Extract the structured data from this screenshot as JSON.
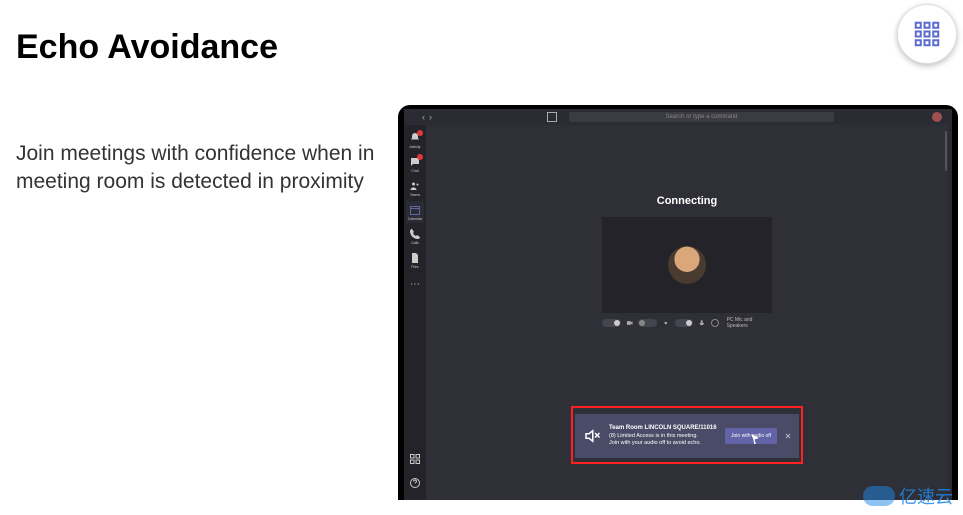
{
  "slide": {
    "title": "Echo Avoidance",
    "subtitle": "Join meetings with confidence when in meeting room is detected in proximity"
  },
  "corner_button": {
    "icon": "building-grid-icon"
  },
  "teams": {
    "topbar": {
      "search_placeholder": "Search or type a command"
    },
    "sidebar": {
      "items": [
        {
          "name": "activity",
          "label": "Activity",
          "badge": true
        },
        {
          "name": "chat",
          "label": "Chat",
          "badge": true
        },
        {
          "name": "teams",
          "label": "Teams",
          "badge": false
        },
        {
          "name": "calendar",
          "label": "Calendar",
          "badge": false,
          "active": true
        },
        {
          "name": "calls",
          "label": "Calls",
          "badge": false
        },
        {
          "name": "files",
          "label": "Files",
          "badge": false
        },
        {
          "name": "more",
          "label": "",
          "badge": false
        }
      ]
    },
    "main": {
      "status": "Connecting",
      "toolbar_device_label": "PC Mic and Speakers"
    },
    "toast": {
      "room_name": "Team Room LINCOLN SQUARE/11016",
      "line2": "(8) Limited Access is in this meeting.",
      "line3": "Join with your audio off to avoid echo.",
      "button_label": "Join with audio off",
      "close_label": "✕"
    }
  },
  "watermark": "亿速云"
}
